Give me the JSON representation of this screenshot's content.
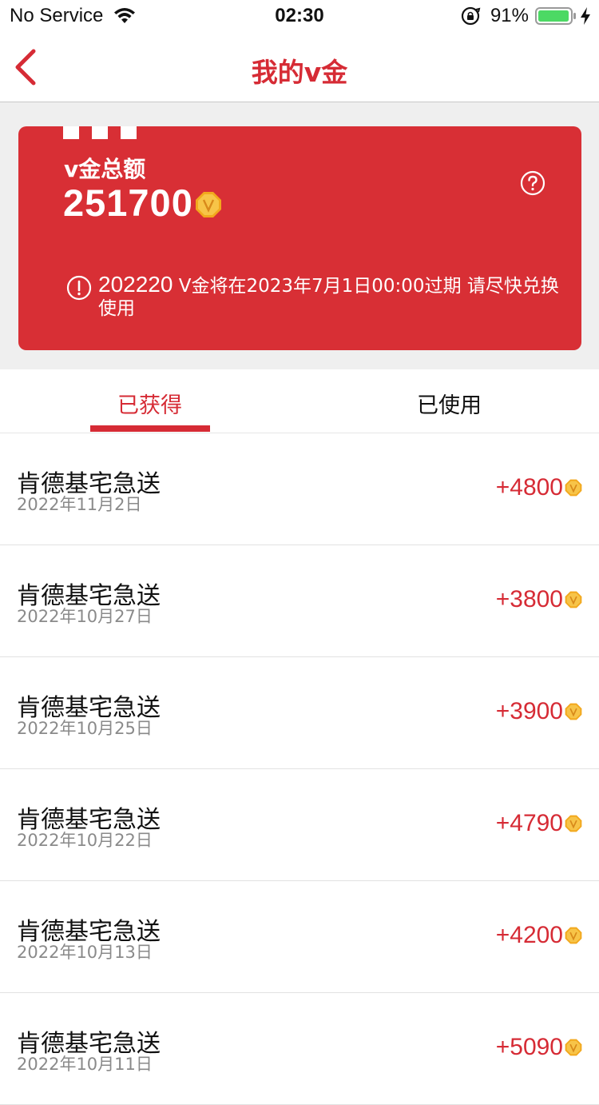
{
  "status_bar": {
    "carrier": "No Service",
    "time": "02:30",
    "battery": "91%"
  },
  "nav": {
    "title": "我的v金"
  },
  "summary": {
    "label": "v金总额",
    "total": "251700",
    "expiring_amount": "202220",
    "notice_text": " V金将在2023年7月1日00:00过期 请尽快兑换使用"
  },
  "tabs": [
    {
      "label": "已获得",
      "active": true
    },
    {
      "label": "已使用",
      "active": false
    }
  ],
  "records": [
    {
      "title": "肯德基宅急送",
      "date": "2022年11月2日",
      "amount": "+4800"
    },
    {
      "title": "肯德基宅急送",
      "date": "2022年10月27日",
      "amount": "+3800"
    },
    {
      "title": "肯德基宅急送",
      "date": "2022年10月25日",
      "amount": "+3900"
    },
    {
      "title": "肯德基宅急送",
      "date": "2022年10月22日",
      "amount": "+4790"
    },
    {
      "title": "肯德基宅急送",
      "date": "2022年10月13日",
      "amount": "+4200"
    },
    {
      "title": "肯德基宅急送",
      "date": "2022年10月11日",
      "amount": "+5090"
    }
  ],
  "icons": {
    "back": "chevron-left-icon",
    "help": "question-circle-icon",
    "notice": "exclamation-circle-icon",
    "coin": "v-coin-icon"
  },
  "colors": {
    "brand_red": "#d62b35",
    "card_red": "#d82f35",
    "coin_gold": "#f2a81d",
    "battery_green": "#4cd964"
  }
}
